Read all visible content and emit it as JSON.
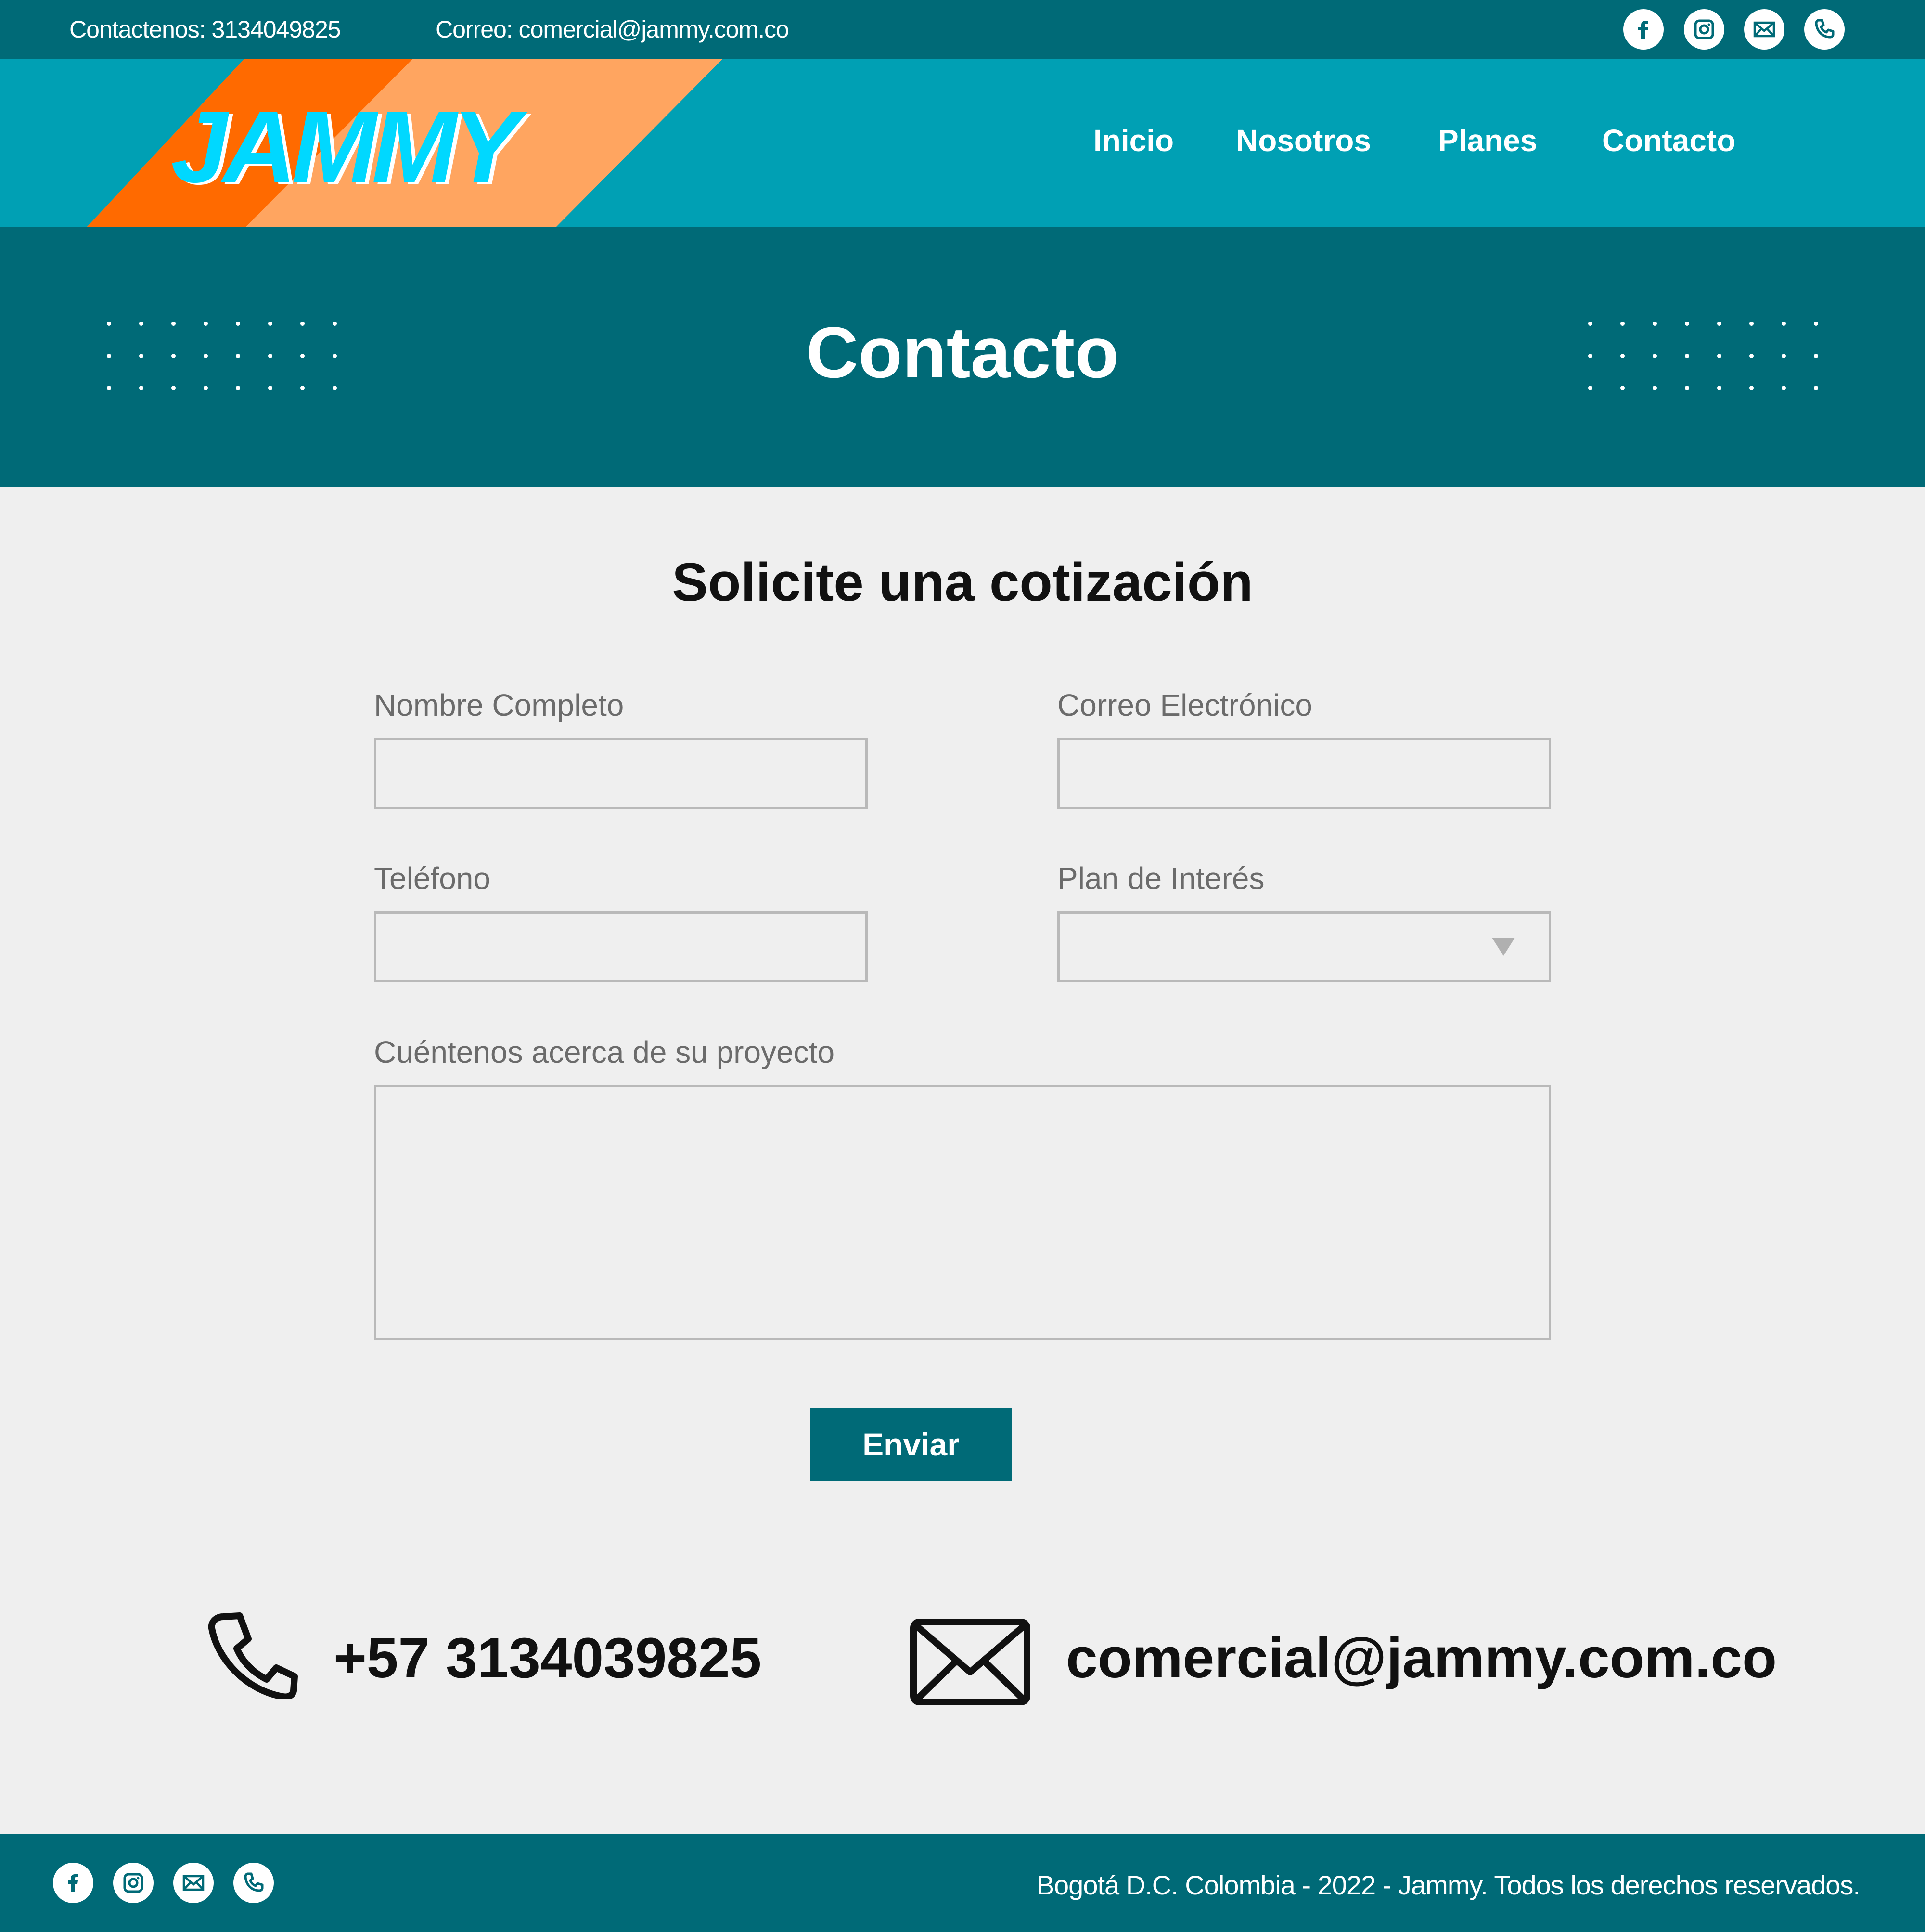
{
  "topbar": {
    "phone_text": "Contactenos: 3134049825",
    "email_text": "Correo: comercial@jammy.com.co",
    "social_icons": [
      "facebook-icon",
      "instagram-icon",
      "mail-icon",
      "phone-icon"
    ]
  },
  "logo": {
    "text": "JAMMY"
  },
  "nav": {
    "items": [
      {
        "label": "Inicio"
      },
      {
        "label": "Nosotros"
      },
      {
        "label": "Planes"
      },
      {
        "label": "Contacto"
      }
    ]
  },
  "hero": {
    "title": "Contacto"
  },
  "form": {
    "title": "Solicite una cotización",
    "name_label": "Nombre Completo",
    "email_label": "Correo Electrónico",
    "phone_label": "Teléfono",
    "plan_label": "Plan de Interés",
    "project_label": "Cuéntenos acerca de su proyecto",
    "name_value": "",
    "email_value": "",
    "phone_value": "",
    "plan_value": "",
    "project_value": "",
    "submit_label": "Enviar"
  },
  "contact": {
    "phone": "+57 3134039825",
    "email": "comercial@jammy.com.co"
  },
  "footer": {
    "copyright": "Bogotá D.C. Colombia - 2022 - Jammy. Todos los derechos reservados."
  },
  "colors": {
    "dark_teal": "#006a77",
    "teal": "#00a0b4",
    "orange": "#ff6a00",
    "light_orange": "#ffa560",
    "logo_cyan": "#00d8ff",
    "background": "#efefef"
  }
}
